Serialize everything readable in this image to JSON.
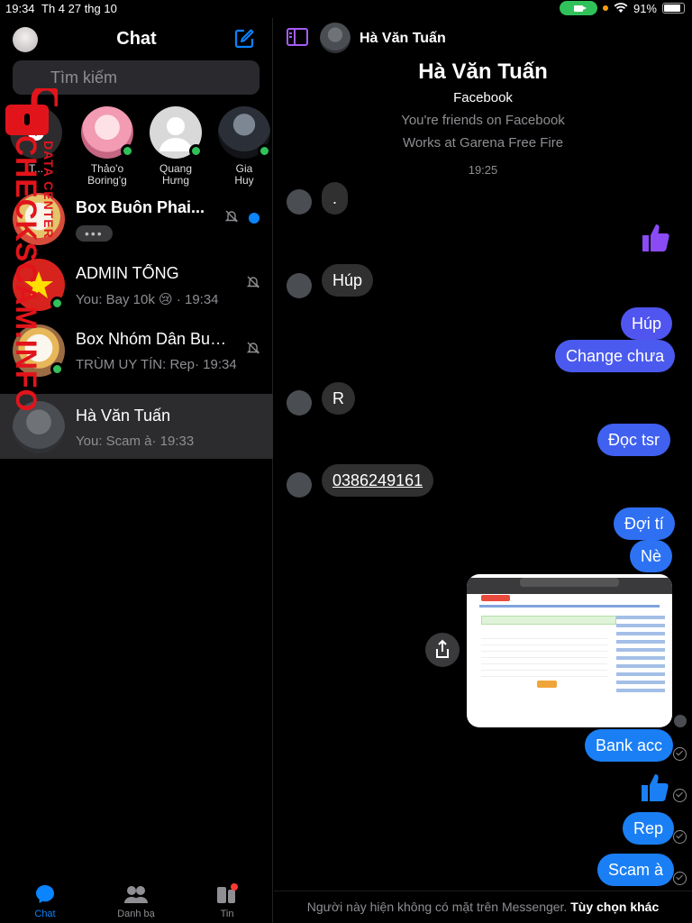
{
  "status_bar": {
    "time": "19:34",
    "date": "Th 4 27 thg 10",
    "battery": "91%"
  },
  "left": {
    "title": "Chat",
    "search_placeholder": "Tìm kiếm",
    "stories": [
      {
        "name_line1": "T...",
        "name_line2": "",
        "kind": "add"
      },
      {
        "name_line1": "Thảo'o",
        "name_line2": "Boring'g",
        "online": true
      },
      {
        "name_line1": "Quang",
        "name_line2": "Hưng",
        "online": true
      },
      {
        "name_line1": "Gia",
        "name_line2": "Huy",
        "online": true
      }
    ],
    "threads": [
      {
        "title": "Box Buôn Phai...",
        "preview": "•••",
        "muted": true,
        "unread": true,
        "bold": true
      },
      {
        "title": "ADMIN TỔNG",
        "preview": "You: Bay 10k 😢 · 19:34",
        "muted": true,
        "online": true
      },
      {
        "title": "Box Nhóm Dân Buô...",
        "preview": "TRÙM UY TÍN: Rep· 19:34",
        "muted": true,
        "online": true
      },
      {
        "title": "Hà Văn Tuấn",
        "preview": "You: Scam à· 19:33",
        "active": true
      }
    ],
    "tabs": [
      {
        "label": "Chat",
        "selected": true,
        "icon": "chat-bubble-icon"
      },
      {
        "label": "Danh bạ",
        "icon": "people-icon"
      },
      {
        "label": "Tin",
        "icon": "stories-icon",
        "badge": true
      }
    ]
  },
  "watermark": {
    "big": "CHECKSCAM.INFO",
    "small": "DATA CENTER",
    "icon": "padlock-icon"
  },
  "conversation": {
    "header_name": "Hà Văn Tuấn",
    "profile": {
      "name": "Hà Văn Tuấn",
      "platform": "Facebook",
      "friends": "You're friends on Facebook",
      "work": "Works at Garena Free Fire",
      "timestamp": "19:25"
    },
    "messages": {
      "in_dot": ".",
      "in_hup": "Húp",
      "out_hup": "Húp",
      "out_change": "Change chưa",
      "in_r": "R",
      "out_doc": "Đọc tsr",
      "in_phone": "0386249161",
      "out_doi": "Đợi tí",
      "out_ne": "Nè",
      "out_bank": "Bank acc",
      "out_rep": "Rep",
      "out_scam": "Scam à"
    },
    "footer_status": "Người này hiện không có mặt trên Messenger.",
    "footer_action": "Tùy chọn khác",
    "accent": "#3b5af0"
  }
}
